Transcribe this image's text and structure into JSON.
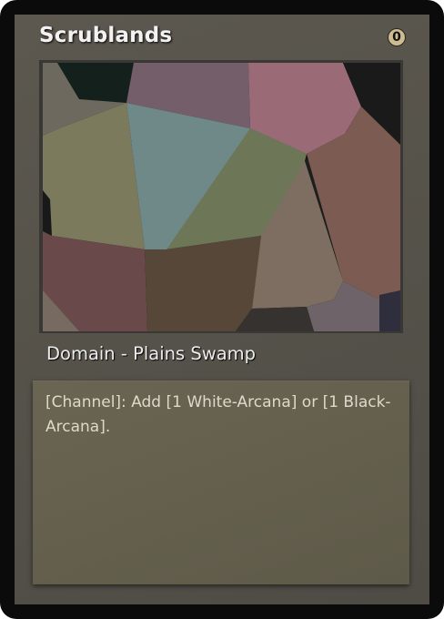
{
  "card": {
    "name": "Scrublands",
    "cost": "0",
    "type_line": "Domain - Plains Swamp",
    "rules_text": "[Channel]: Add [1 White-Arcana] or [1 Black-Arcana]."
  },
  "colors": {
    "frame_border": "#0b0b0b",
    "frame_fill": "#58554d",
    "text_box": "#666150",
    "cost_circle": "#cdbb92",
    "title_text": "#f2f2f2"
  }
}
